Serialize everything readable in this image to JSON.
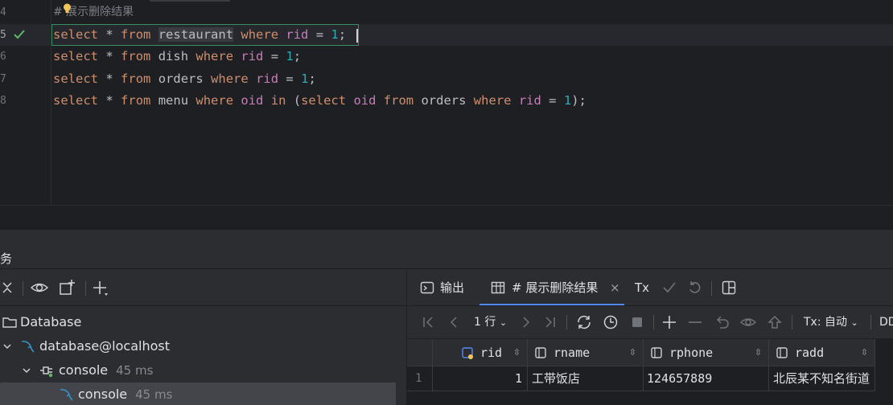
{
  "editor": {
    "comment_line": {
      "number": "4",
      "text": "# 展示删除结果"
    },
    "lines": [
      {
        "number": "5",
        "kw1": "select",
        "star": "*",
        "kw2": "from",
        "table": "restaurant",
        "kw3": "where",
        "col": "rid",
        "eq": "=",
        "val": "1",
        "end": ";"
      },
      {
        "number": "6",
        "kw1": "select",
        "star": "*",
        "kw2": "from",
        "table": "dish",
        "kw3": "where",
        "col": "rid",
        "eq": "=",
        "val": "1",
        "end": ";"
      },
      {
        "number": "7",
        "kw1": "select",
        "star": "*",
        "kw2": "from",
        "table": "orders",
        "kw3": "where",
        "col": "rid",
        "eq": "=",
        "val": "1",
        "end": ";"
      }
    ],
    "line8": {
      "number": "8",
      "kw1": "select",
      "star": "*",
      "kw2": "from",
      "table": "menu",
      "kw3": "where",
      "col": "oid",
      "kw4": "in",
      "paren": "(",
      "kw5": "select",
      "col2": "oid",
      "kw6": "from",
      "table2": "orders",
      "kw7": "where",
      "col3": "rid",
      "eq": "=",
      "val": "1",
      "end": ");"
    }
  },
  "panel": {
    "title": "务"
  },
  "services": {
    "tree": [
      {
        "label": "Database"
      },
      {
        "label": "database@localhost"
      },
      {
        "label": "console",
        "time": "45 ms"
      },
      {
        "label": "console",
        "time": "45 ms"
      }
    ]
  },
  "results": {
    "tabs": [
      {
        "label": "输出"
      },
      {
        "label": "# 展示删除结果",
        "close": "×"
      }
    ],
    "tx_label": "Tx",
    "toolbar": {
      "rows": "1 行",
      "tx_mode": "Tx: 自动",
      "ddl": "DD"
    },
    "columns": [
      "rid",
      "rname",
      "rphone",
      "radd"
    ],
    "rows": [
      {
        "num": "1",
        "rid": "1",
        "rname": "工带饭店",
        "rphone": "124657889",
        "radd": "北辰某不知名街道"
      }
    ]
  },
  "colors": {
    "keyword": "#cf8e6d",
    "number": "#2aacb8",
    "column": "#c77dbb",
    "accent": "#548af7",
    "success": "#5fb865"
  }
}
